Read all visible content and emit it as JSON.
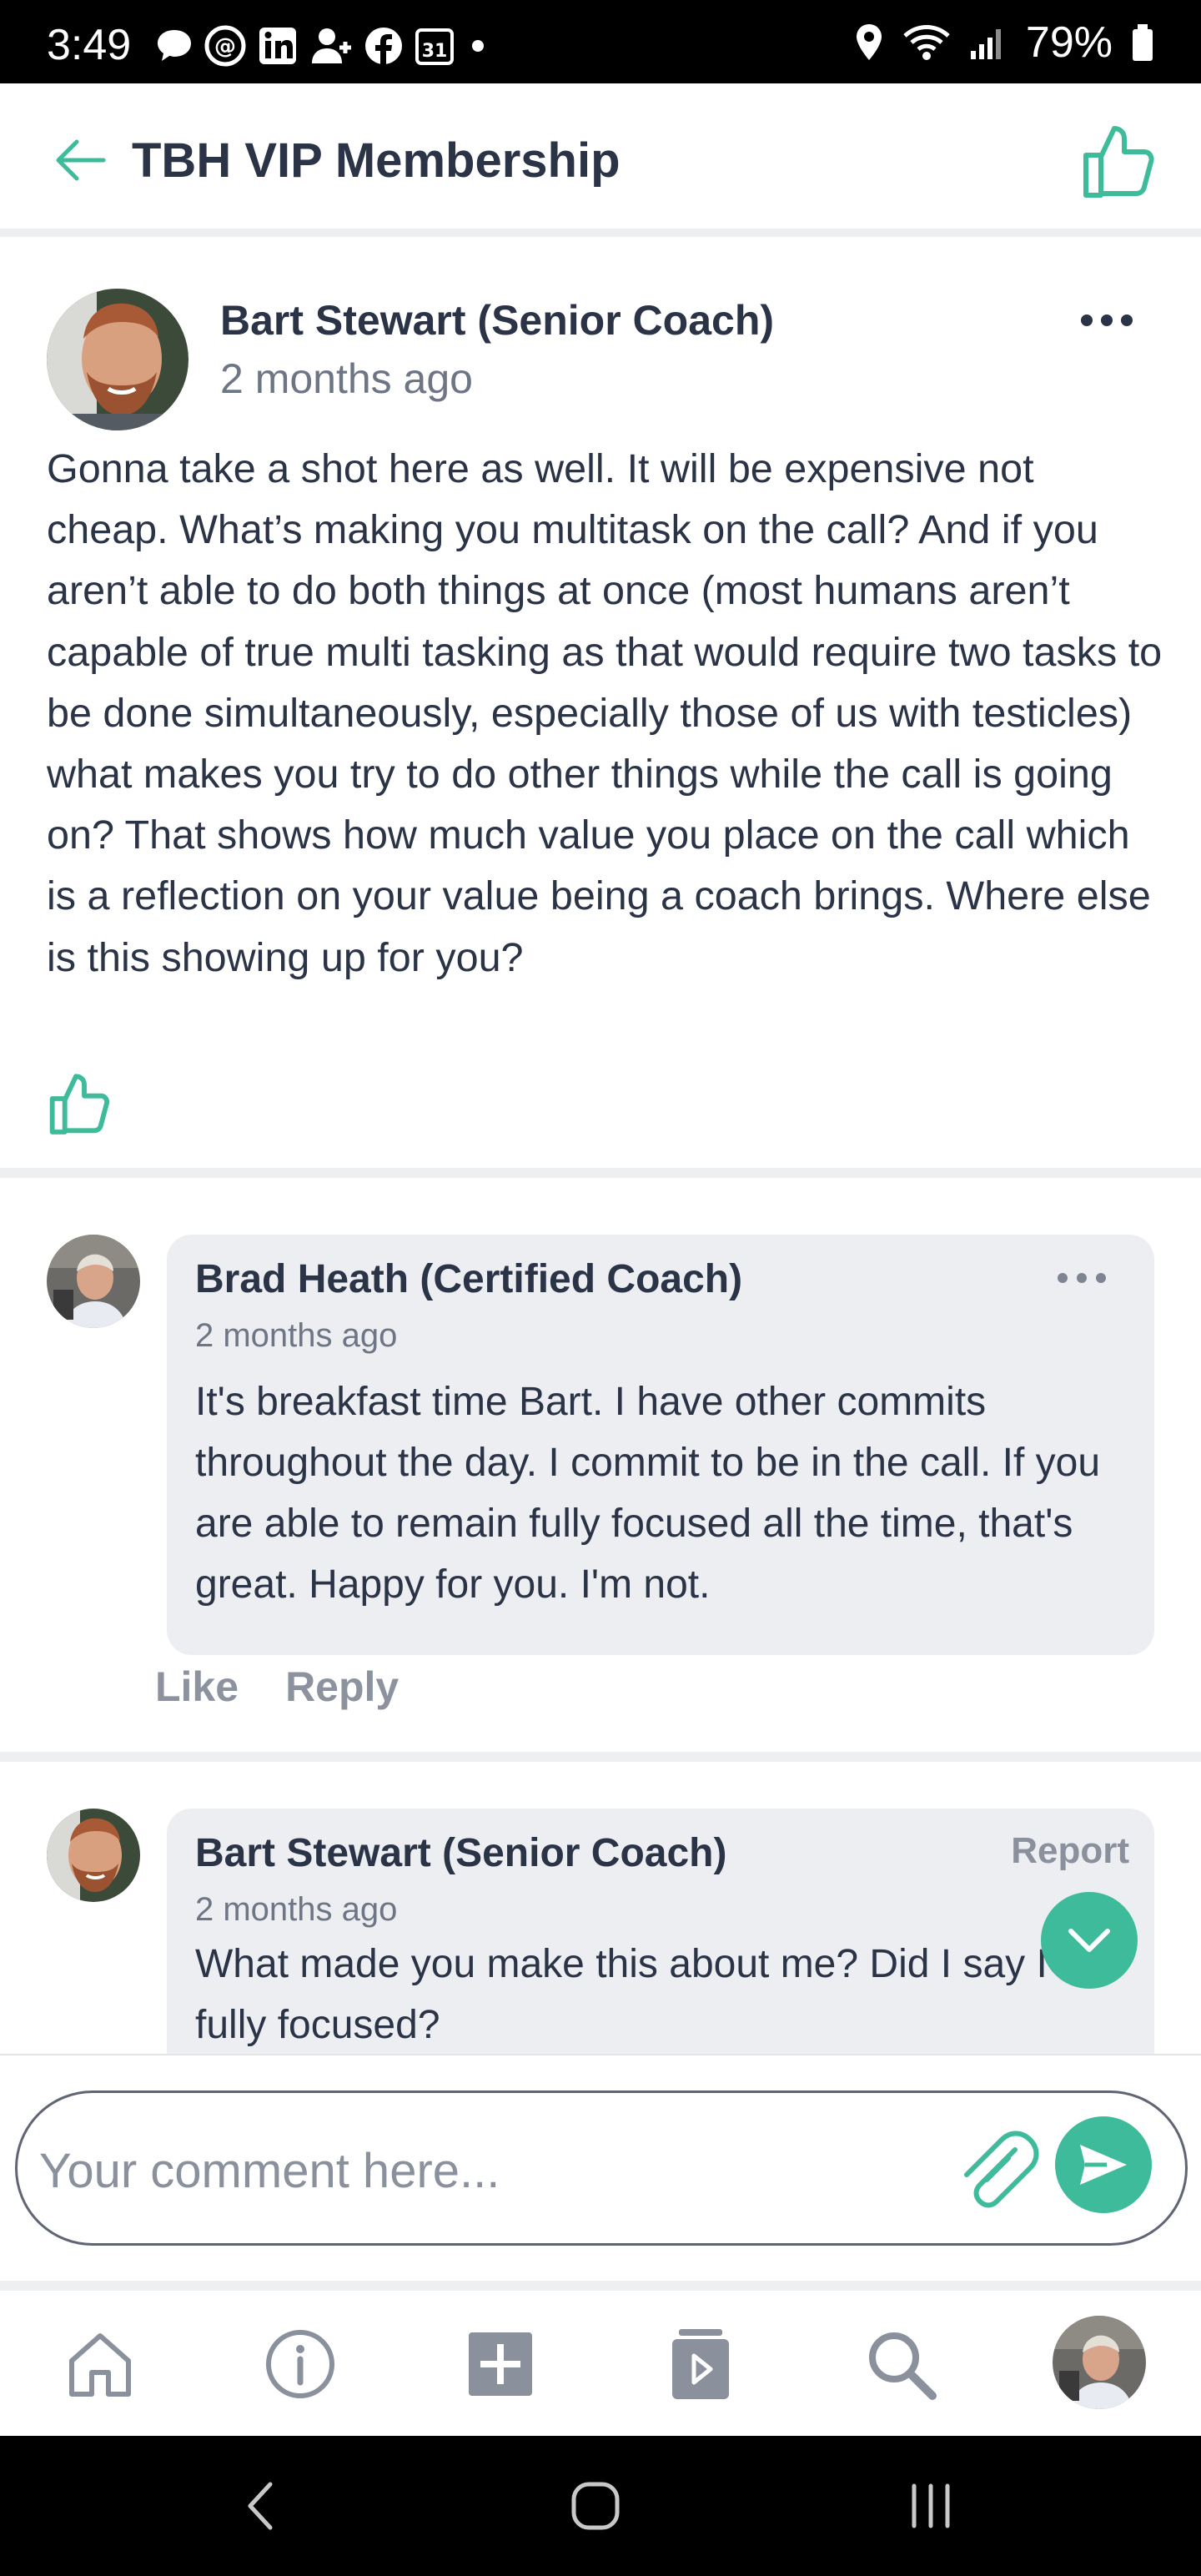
{
  "status_bar": {
    "time": "3:49",
    "calendar_day": "31",
    "battery_percent": "79%",
    "signal_label": "6"
  },
  "header": {
    "title": "TBH VIP Membership",
    "back_icon": "arrow-left-icon",
    "like_icon": "thumbs-up-icon"
  },
  "post": {
    "author": "Bart Stewart (Senior Coach)",
    "time": "2 months ago",
    "body": "Gonna take a shot here as well. It will be expensive not cheap. What’s making you multitask on the call? And if you aren’t able to do both things at once (most humans aren’t capable of true multi tasking as that would require two tasks to be done simultaneously, especially those of us with testicles) what makes you try to do other things while the call is going on? That shows how much value you place on the call which is a reflection on your value being a coach brings. Where else is this showing up for you?"
  },
  "comments": [
    {
      "author": "Brad Heath (Certified Coach)",
      "time": "2 months ago",
      "text": "It's breakfast time Bart.  I have other commits throughout the day.  I commit to be in the call.  If you are able to remain fully focused all the time,  that's great.  Happy for you.   I'm not.",
      "like_label": "Like",
      "reply_label": "Reply"
    },
    {
      "author": "Bart Stewart (Senior Coach)",
      "time": "2 months ago",
      "text": "What made you make this about me? Did I say I am fully focused?",
      "report_label": "Report"
    }
  ],
  "composer": {
    "placeholder": "Your comment here..."
  },
  "bottom_nav": {
    "items": [
      "home-icon",
      "info-icon",
      "add-icon",
      "media-icon",
      "search-icon",
      "profile-avatar"
    ]
  },
  "colors": {
    "accent": "#3dbb9a",
    "text": "#2b3347",
    "muted": "#6e7585",
    "bubble": "#eceef1"
  }
}
